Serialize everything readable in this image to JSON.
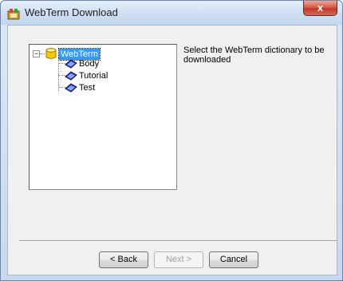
{
  "window": {
    "title": "WebTerm Download",
    "close_label": "x"
  },
  "tree": {
    "root": {
      "label": "WebTerm",
      "expanded": true,
      "expander_symbol": "−",
      "icon": "database-icon"
    },
    "children": [
      {
        "label": "Body",
        "icon": "book-icon"
      },
      {
        "label": "Tutorial",
        "icon": "book-icon"
      },
      {
        "label": "Test",
        "icon": "book-icon"
      }
    ]
  },
  "description": "Select the WebTerm dictionary to be downloaded",
  "buttons": {
    "back": "< Back",
    "next": "Next >",
    "cancel": "Cancel"
  },
  "colors": {
    "selection": "#3399ff",
    "close_button": "#c0392b"
  }
}
